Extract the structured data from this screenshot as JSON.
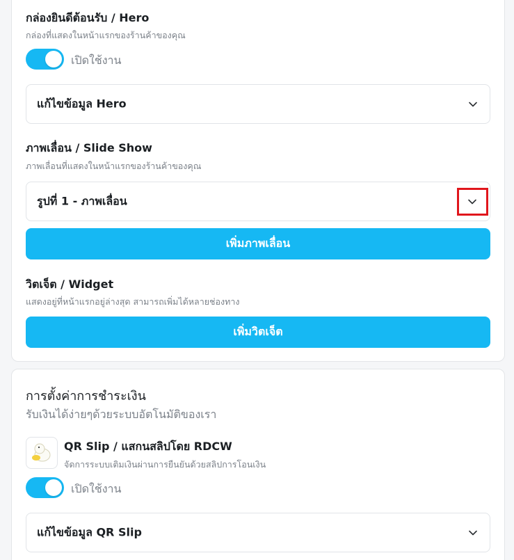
{
  "hero": {
    "title": "กล่องยินดีต้อนรับ / Hero",
    "description": "กล่องที่แสดงในหน้าแรกของร้านค้าของคุณ",
    "toggle_label": "เปิดใช้งาน",
    "toggle_on": true,
    "edit_label": "แก้ไขข้อมูล Hero"
  },
  "slideshow": {
    "title": "ภาพเลื่อน / Slide Show",
    "description": "ภาพเลื่อนที่แสดงในหน้าแรกของร้านค้าของคุณ",
    "item_label": "รูปที่ 1 - ภาพเลื่อน",
    "add_button": "เพิ่มภาพเลื่อน"
  },
  "widget": {
    "title": "วิตเจ็ต / Widget",
    "description": "แสดงอยู่ที่หน้าแรกอยู่ล่างสุด สามารถเพิ่มได้หลายช่องทาง",
    "add_button": "เพิ่มวิตเจ็ต"
  },
  "payment": {
    "title": "การตั้งค่าการชำระเงิน",
    "subtitle": "รับเงินได้ง่ายๆด้วยระบบอัตโนมัติของเรา",
    "provider": {
      "icon": "duck-logo-icon",
      "name": "QR Slip / แสกนสลิปโดย RDCW",
      "description": "จัดการระบบเติมเงินผ่านการยืนยันด้วยสลิปการโอนเงิน",
      "toggle_label": "เปิดใช้งาน",
      "toggle_on": true,
      "edit_label": "แก้ไขข้อมูล QR Slip"
    }
  },
  "colors": {
    "accent": "#16b8f3",
    "highlight": "#e0161c"
  }
}
